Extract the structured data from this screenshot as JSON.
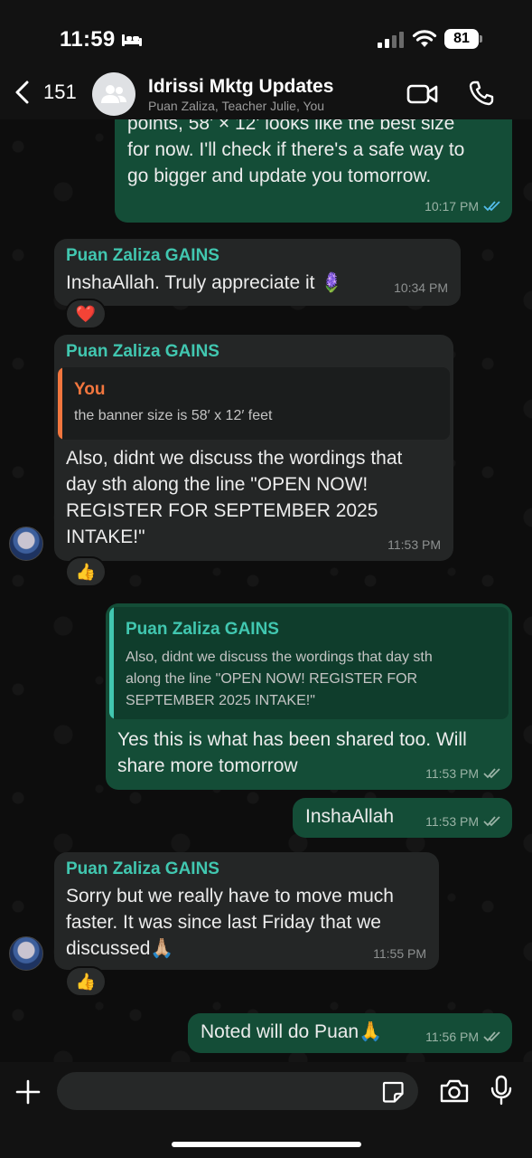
{
  "status_bar": {
    "time": "11:59",
    "battery": "81"
  },
  "header": {
    "back_count": "151",
    "title": "Idrissi Mktg Updates",
    "subtitle": "Puan Zaliza, Teacher Julie, You"
  },
  "messages": [
    {
      "type": "outgoing",
      "text": "points, 58' × 12' looks like the best size\nfor now. I'll check if there's a safe way to\ngo bigger and update you tomorrow.",
      "time": "10:17 PM",
      "status": "read"
    },
    {
      "type": "incoming",
      "sender": "Puan Zaliza GAINS",
      "text": "InshaAllah. Truly appreciate it 🪻",
      "time": "10:34 PM",
      "reaction": "❤️"
    },
    {
      "type": "incoming",
      "sender": "Puan Zaliza GAINS",
      "quote_name": "You",
      "quote_text": "the banner size is 58′ x 12′ feet",
      "text": "Also, didnt we discuss the wordings that\nday sth along the line \"OPEN NOW!\nREGISTER FOR SEPTEMBER 2025\nINTAKE!\"",
      "time": "11:53 PM",
      "reaction": "👍"
    },
    {
      "type": "outgoing",
      "quote_name": "Puan Zaliza GAINS",
      "quote_text": "Also, didnt we discuss the wordings that day sth\nalong the line \"OPEN NOW! REGISTER FOR\nSEPTEMBER 2025 INTAKE!\"",
      "text": "Yes this is what has been shared too. Will\nshare more tomorrow",
      "time": "11:53 PM",
      "status": "delivered"
    },
    {
      "type": "outgoing",
      "text": "InshaAllah",
      "time": "11:53 PM",
      "status": "delivered"
    },
    {
      "type": "incoming",
      "sender": "Puan Zaliza GAINS",
      "text": "Sorry but we really have to move much\nfaster. It was since last Friday that we\ndiscussed🙏🏼",
      "time": "11:55 PM",
      "reaction": "👍"
    },
    {
      "type": "outgoing",
      "text": "Noted will do Puan🙏",
      "time": "11:56 PM",
      "status": "delivered"
    }
  ],
  "input": {
    "placeholder": ""
  },
  "colors": {
    "outgoing_bubble": "#144d37",
    "incoming_bubble": "#242626",
    "sender_name": "#41c7b0",
    "quote_you": "#f2763e",
    "read_tick": "#53bdeb"
  }
}
